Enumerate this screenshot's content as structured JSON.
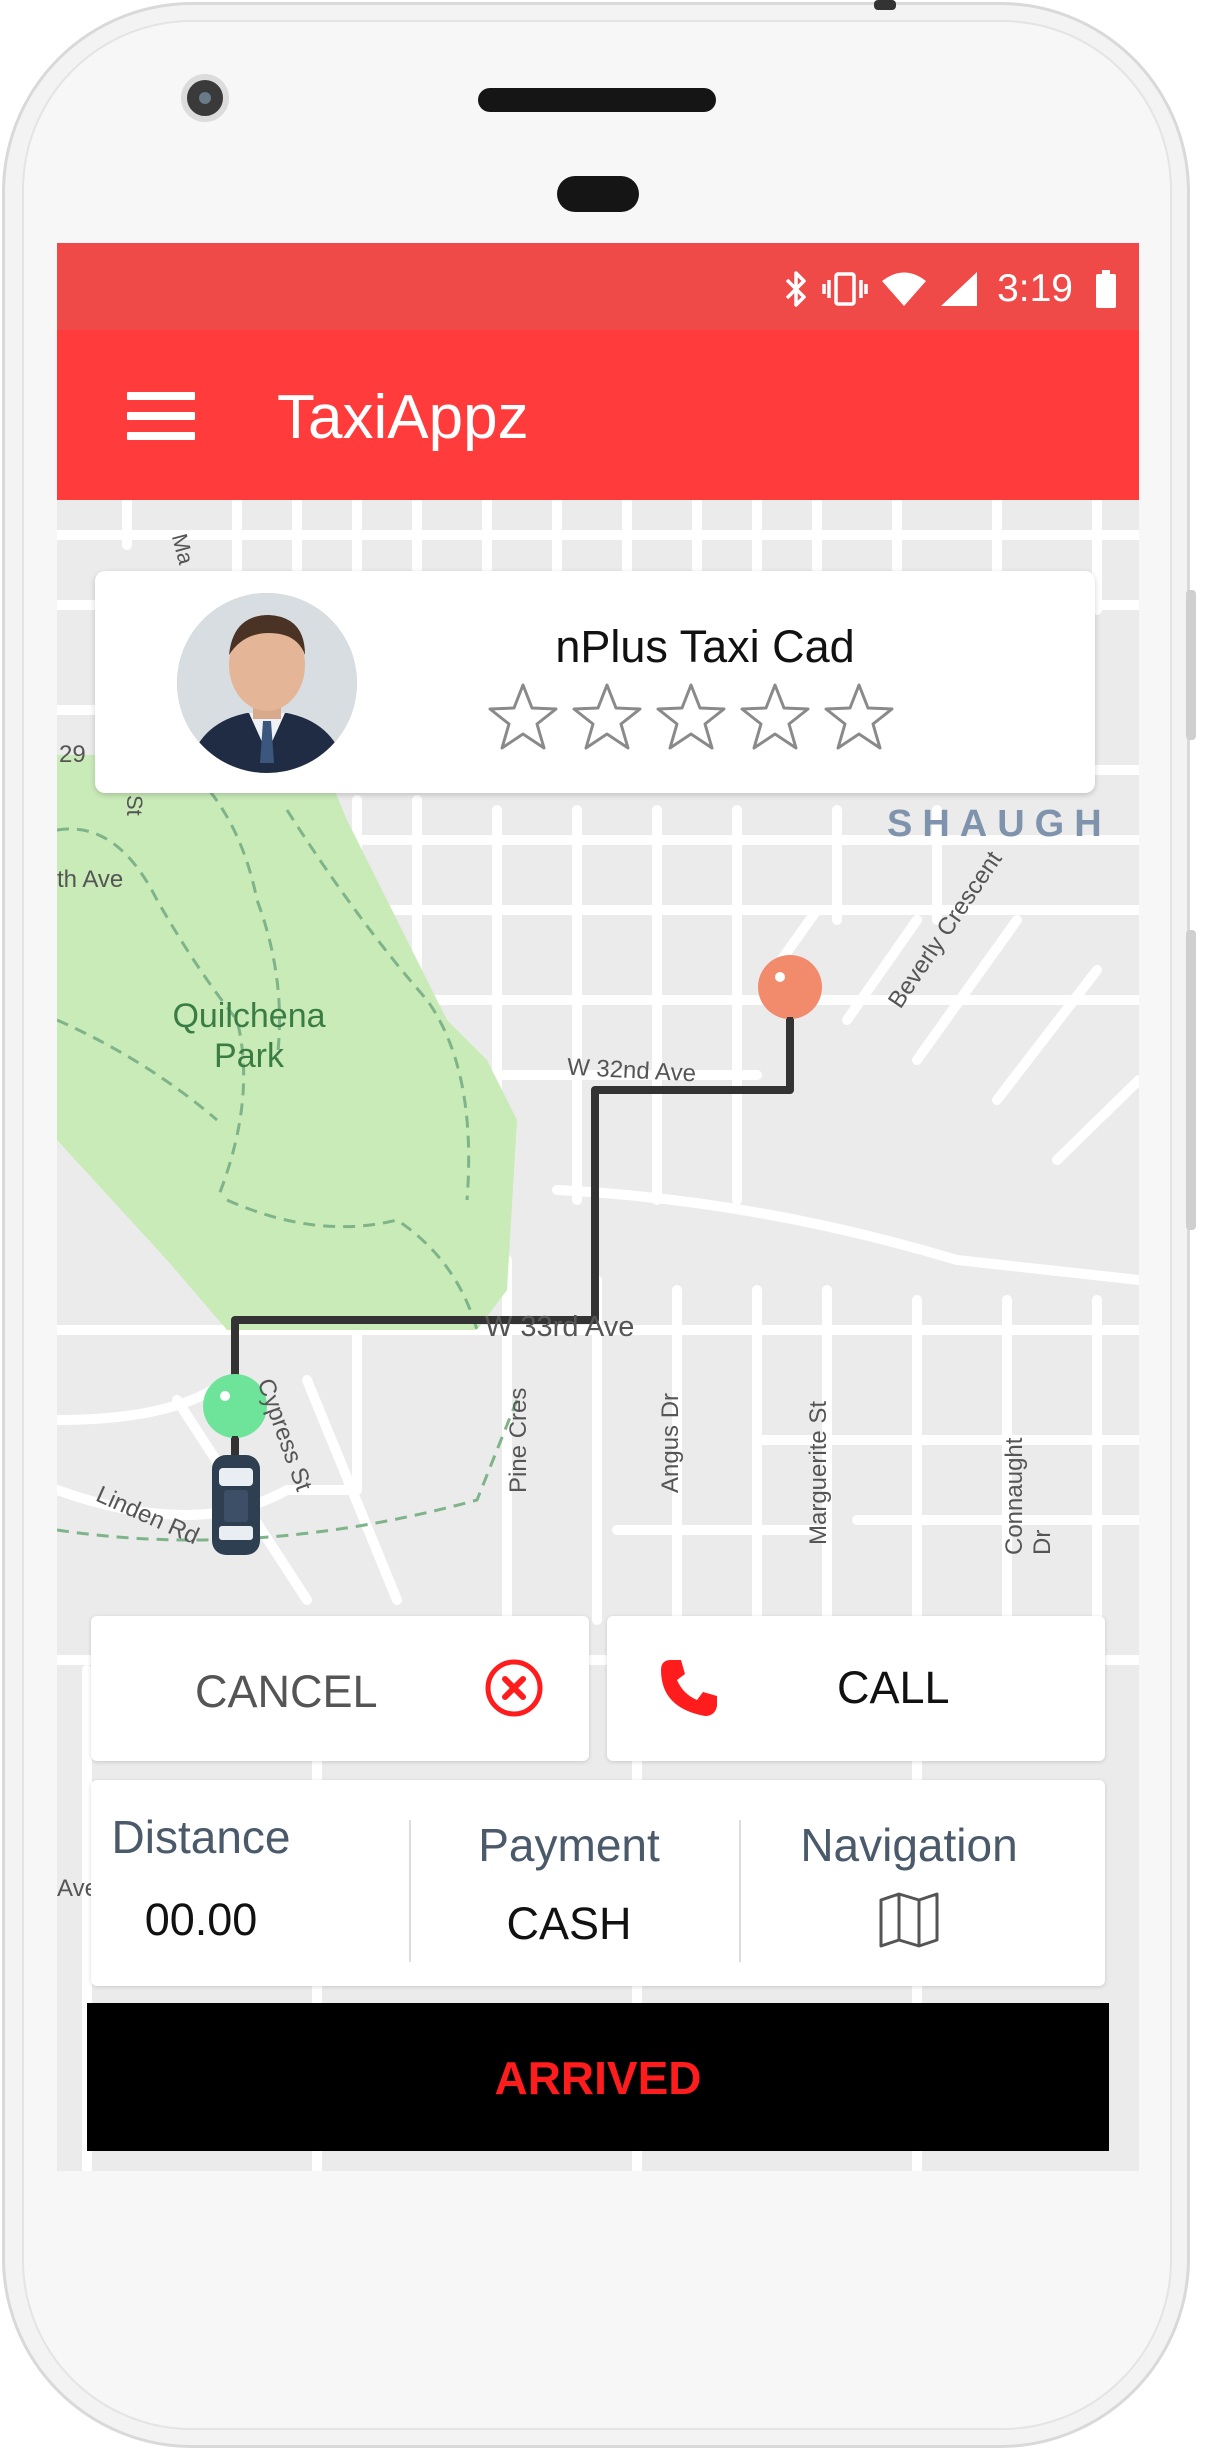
{
  "status_bar": {
    "time": "3:19"
  },
  "app_bar": {
    "title": "TaxiAppz"
  },
  "driver": {
    "name": "nPlus Taxi Cad",
    "rating_stars": 5,
    "rating": 0
  },
  "map": {
    "labels": {
      "park": "Quilchena Park",
      "street_33rd": "W 33rd Ave",
      "street_32nd": "W 32nd Ave",
      "beverly": "Beverly Crescent",
      "cypress": "Cypress St",
      "pine": "Pine Cres",
      "angus": "Angus Dr",
      "marguerite": "Marguerite St",
      "connaught": "Connaught Dr",
      "linden": "Linden Rd",
      "neighbourhood": "SHAUGH",
      "ave_left": "th Ave",
      "num_29": "29",
      "st_left": "St",
      "ma": "Ma",
      "ave_bottom": "Ave"
    }
  },
  "actions": {
    "cancel_label": "CANCEL",
    "call_label": "CALL"
  },
  "info": {
    "distance_label": "Distance",
    "distance_value": "00.00",
    "payment_label": "Payment",
    "payment_value": "CASH",
    "navigation_label": "Navigation"
  },
  "arrived_label": "ARRIVED",
  "colors": {
    "app_bar": "#ff3b3b",
    "status_bar": "#ef4a48",
    "arrived_text": "#ff1c1c",
    "pickup_marker": "#6ee39a",
    "drop_marker": "#f28a6c",
    "route": "#333333"
  },
  "icons": [
    "menu-icon",
    "bluetooth-icon",
    "vibrate-icon",
    "wifi-icon",
    "signal-icon",
    "battery-icon",
    "star-icon",
    "cancel-circle-icon",
    "phone-icon",
    "map-icon",
    "car-icon"
  ]
}
